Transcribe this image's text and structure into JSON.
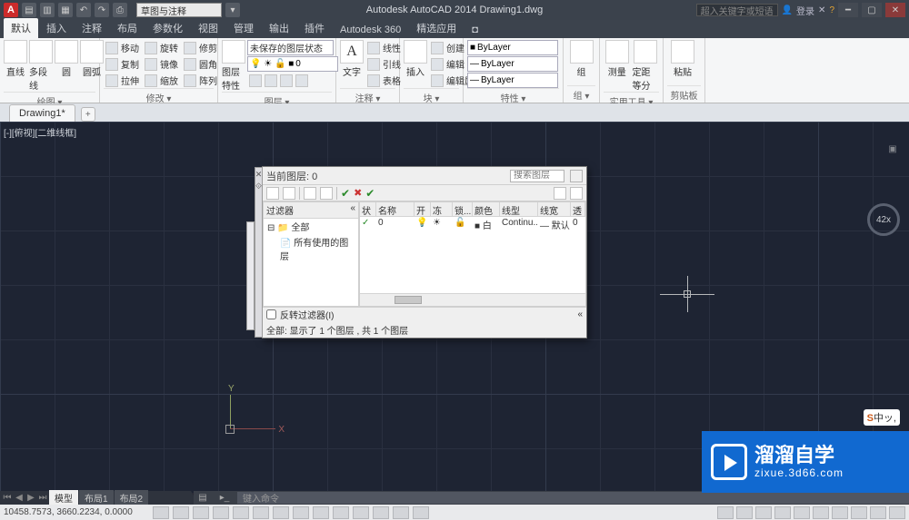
{
  "frame": {
    "app_icon": "A",
    "qsearch": "草图与注释",
    "title": "Autodesk AutoCAD 2014   Drawing1.dwg",
    "right_search_ph": "超入关键字或短语",
    "user": "登录"
  },
  "menu_tabs": [
    "默认",
    "插入",
    "注释",
    "布局",
    "参数化",
    "视图",
    "管理",
    "输出",
    "插件",
    "Autodesk 360",
    "精选应用",
    "◘"
  ],
  "ribbon": {
    "draw": {
      "name": "绘图 ▾",
      "items": [
        "直线",
        "多段线",
        "圆",
        "圆弧"
      ]
    },
    "modify": {
      "name": "修改 ▾",
      "rows": [
        [
          "移动",
          "旋转",
          "修剪"
        ],
        [
          "复制",
          "镜像",
          "圆角"
        ],
        [
          "拉伸",
          "缩放",
          "阵列"
        ]
      ]
    },
    "layer": {
      "name": "图层 ▾",
      "big": "图层特性",
      "big2": "未保存的图层状态",
      "combo": "0"
    },
    "annot": {
      "name": "注释 ▾",
      "big": "文字",
      "rows": [
        "线性",
        "引线",
        "表格"
      ]
    },
    "block": {
      "name": "块 ▾",
      "big": "插入",
      "rows": [
        "创建",
        "编辑",
        "编辑属性"
      ]
    },
    "prop": {
      "name": "特性 ▾",
      "rows": [
        "ByLayer",
        "ByLayer",
        "ByLayer"
      ]
    },
    "group": {
      "name": "组 ▾",
      "big": "组"
    },
    "util": {
      "name": "实用工具 ▾",
      "big": "测量",
      "big2": "定距等分"
    },
    "clip": {
      "name": "剪贴板",
      "big": "粘贴"
    }
  },
  "doc_tabs": {
    "tab1": "Drawing1*"
  },
  "canvas": {
    "corner": "[-][俯视][二维线框]",
    "ucs_x": "X",
    "ucs_y": "Y",
    "zoom": "42x"
  },
  "layer_dialog": {
    "current_label": "当前图层: 0",
    "search_ph": "搜索图层",
    "tree_header": "过滤器",
    "tree_root": "全部",
    "tree_child": "所有使用的图层",
    "columns": [
      "状",
      "名称",
      "开",
      "冻结",
      "锁...",
      "颜色",
      "线型",
      "线宽",
      "透明"
    ],
    "row0": {
      "status": "✓",
      "name": "0",
      "on": "💡",
      "freeze": "☀",
      "lock": "🔓",
      "color": "■ 白",
      "ltype": "Continu...",
      "lw": "— 默认",
      "tr": "0"
    },
    "invert_label": "反转过滤器(I)",
    "status_line": "全部: 显示了 1 个图层 , 共 1 个图层"
  },
  "model_tabs": {
    "t0": "模型",
    "t1": "布局1",
    "t2": "布局2"
  },
  "cmd": {
    "placeholder": "键入命令"
  },
  "statusbar": {
    "coords": "10458.7573, 3660.2234, 0.0000"
  },
  "watermark": {
    "big": "溜溜自学",
    "small": "zixue.3d66.com"
  },
  "lang_badge": {
    "s": "S",
    "rest": "中ッ,"
  }
}
